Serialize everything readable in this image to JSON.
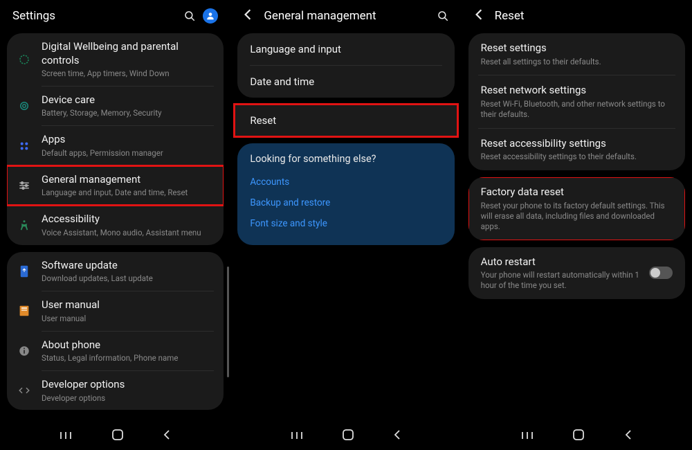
{
  "screen1": {
    "title": "Settings",
    "groups": [
      {
        "items": [
          {
            "title": "Digital Wellbeing and parental controls",
            "sub": "Screen time, App timers, Wind Down"
          },
          {
            "title": "Device care",
            "sub": "Battery, Storage, Memory, Security"
          },
          {
            "title": "Apps",
            "sub": "Default apps, Permission manager"
          },
          {
            "title": "General management",
            "sub": "Language and input, Date and time, Reset"
          },
          {
            "title": "Accessibility",
            "sub": "Voice Assistant, Mono audio, Assistant menu"
          }
        ]
      },
      {
        "items": [
          {
            "title": "Software update",
            "sub": "Download updates, Last update"
          },
          {
            "title": "User manual",
            "sub": "User manual"
          },
          {
            "title": "About phone",
            "sub": "Status, Legal information, Phone name"
          },
          {
            "title": "Developer options",
            "sub": "Developer options"
          }
        ]
      }
    ]
  },
  "screen2": {
    "title": "General management",
    "items": [
      {
        "label": "Language and input"
      },
      {
        "label": "Date and time"
      },
      {
        "label": "Reset"
      }
    ],
    "suggest_title": "Looking for something else?",
    "suggest_links": [
      "Accounts",
      "Backup and restore",
      "Font size and style"
    ]
  },
  "screen3": {
    "title": "Reset",
    "groups": [
      [
        {
          "title": "Reset settings",
          "sub": "Reset all settings to their defaults."
        },
        {
          "title": "Reset network settings",
          "sub": "Reset Wi-Fi, Bluetooth, and other network settings to their defaults."
        },
        {
          "title": "Reset accessibility settings",
          "sub": "Reset accessibility settings to their defaults."
        }
      ],
      [
        {
          "title": "Factory data reset",
          "sub": "Reset your phone to its factory default settings. This will erase all data, including files and downloaded apps."
        }
      ],
      [
        {
          "title": "Auto restart",
          "sub": "Your phone will restart automatically within 1 hour of the time you set."
        }
      ]
    ]
  }
}
